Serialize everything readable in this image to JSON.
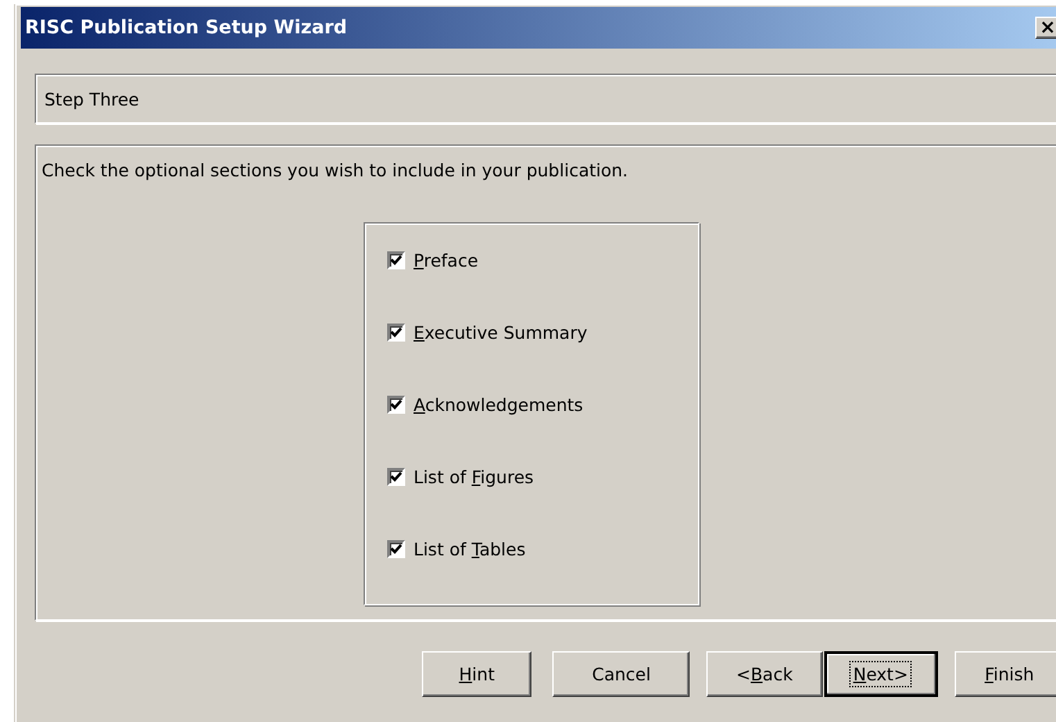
{
  "window": {
    "title": "RISC Publication Setup Wizard",
    "close_glyph": "×"
  },
  "step": {
    "title": "Step Three"
  },
  "instruction": "Check the optional sections you wish to include in your publication.",
  "options": [
    {
      "key": "P",
      "after": "reface",
      "checked": true
    },
    {
      "key": "E",
      "after": "xecutive Summary",
      "checked": true
    },
    {
      "key": "A",
      "after": "cknowledgements",
      "checked": true
    },
    {
      "before": "List of ",
      "key": "F",
      "after": "igures",
      "checked": true
    },
    {
      "before": "List of ",
      "key": "T",
      "after": "ables",
      "checked": true
    }
  ],
  "buttons": [
    {
      "key": "H",
      "after": "int",
      "default": false
    },
    {
      "before": "Cancel",
      "default": false
    },
    {
      "before": "<",
      "key": "B",
      "after": "ack",
      "default": false
    },
    {
      "key": "N",
      "after": "ext>",
      "default": true
    },
    {
      "key": "F",
      "after": "inish",
      "default": false
    }
  ]
}
